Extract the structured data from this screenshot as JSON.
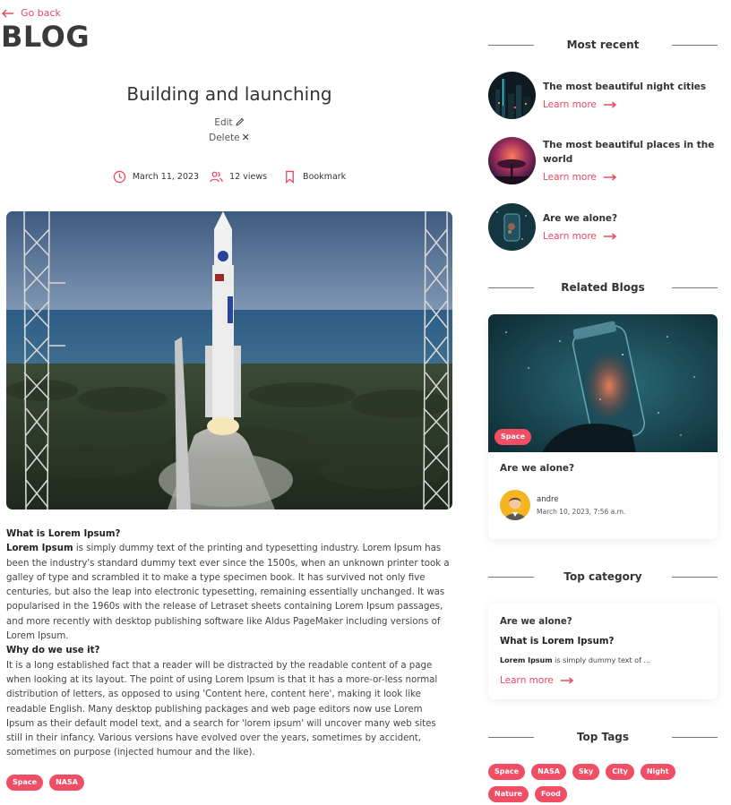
{
  "header": {
    "go_back": "Go back",
    "blog_title": "BLOG"
  },
  "post": {
    "title": "Building and launching",
    "edit_label": "Edit",
    "delete_label": "Delete",
    "date": "March 11, 2023",
    "views": "12 views",
    "bookmark_label": "Bookmark",
    "heading1": "What is Lorem Ipsum?",
    "p1_bold": "Lorem Ipsum",
    "p1": " is simply dummy text of the printing and typesetting industry. Lorem Ipsum has been the industry's standard dummy text ever since the 1500s, when an unknown printer took a galley of type and scrambled it to make a type specimen book. It has survived not only five centuries, but also the leap into electronic typesetting, remaining essentially unchanged. It was popularised in the 1960s with the release of Letraset sheets containing Lorem Ipsum passages, and more recently with desktop publishing software like Aldus PageMaker including versions of Lorem Ipsum.",
    "heading2": "Why do we use it?",
    "p2": "It is a long established fact that a reader will be distracted by the readable content of a page when looking at its layout. The point of using Lorem Ipsum is that it has a more-or-less normal distribution of letters, as opposed to using 'Content here, content here', making it look like readable English. Many desktop publishing packages and web page editors now use Lorem Ipsum as their default model text, and a search for 'lorem ipsum' will uncover many web sites still in their infancy. Various versions have evolved over the years, sometimes by accident, sometimes on purpose (injected humour and the like).",
    "tags": [
      "Space",
      "NASA"
    ]
  },
  "sidebar": {
    "most_recent_heading": "Most recent",
    "recent": [
      {
        "title": "The most beautiful night cities",
        "link": "Learn more"
      },
      {
        "title": "The most beautiful places in the world",
        "link": "Learn more"
      },
      {
        "title": "Are we alone?",
        "link": "Learn more"
      }
    ],
    "related_heading": "Related Blogs",
    "related": {
      "tag": "Space",
      "title": "Are we alone?",
      "author": "andre",
      "date": "March 10, 2023, 7:56 a.m."
    },
    "top_category_heading": "Top category",
    "top_category": {
      "title": "Are we alone?",
      "subtitle": "What is Lorem Ipsum?",
      "excerpt_bold": "Lorem Ipsum",
      "excerpt": " is simply dummy text of ...",
      "link": "Learn more"
    },
    "top_tags_heading": "Top Tags",
    "tags": [
      "Space",
      "NASA",
      "Sky",
      "City",
      "Night",
      "Nature",
      "Food"
    ]
  },
  "colors": {
    "accent": "#e84a62",
    "tag_bg": "#f04e65"
  }
}
